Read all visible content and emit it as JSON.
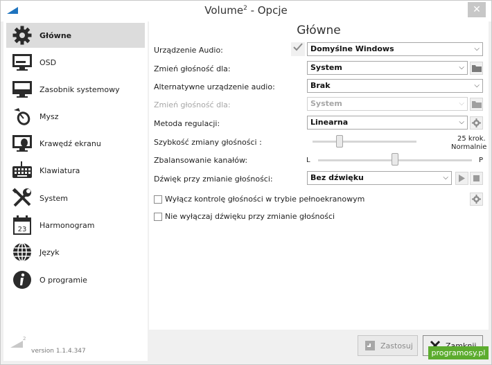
{
  "window": {
    "title": "Volume",
    "title_sup": "2",
    "title_suffix": " - Opcje",
    "close_glyph": "✕"
  },
  "sidebar": {
    "items": [
      {
        "label": "Główne",
        "icon": "gear-icon",
        "active": true
      },
      {
        "label": "OSD",
        "icon": "monitor-icon"
      },
      {
        "label": "Zasobnik systemowy",
        "icon": "tray-icon"
      },
      {
        "label": "Mysz",
        "icon": "mouse-icon"
      },
      {
        "label": "Krawędź ekranu",
        "icon": "screen-edge-icon"
      },
      {
        "label": "Klawiatura",
        "icon": "keyboard-icon"
      },
      {
        "label": "System",
        "icon": "tools-icon"
      },
      {
        "label": "Harmonogram",
        "icon": "calendar-icon"
      },
      {
        "label": "Język",
        "icon": "globe-icon"
      },
      {
        "label": "O programie",
        "icon": "info-icon"
      }
    ],
    "calendar_day": "23",
    "version": "version 1.1.4.347",
    "version_logo_sup": "2"
  },
  "main": {
    "title": "Główne",
    "audio_device": {
      "label": "Urządzenie Audio:",
      "value": "Domyślne Windows",
      "checked": true
    },
    "change_volume_for": {
      "label": "Zmień głośność dla:",
      "value": "System"
    },
    "alt_audio_device": {
      "label": "Alternatywne urządzenie audio:",
      "value": "Brak"
    },
    "change_volume_for_disabled": {
      "label": "Zmień głośność dla:",
      "value": "System"
    },
    "regulation_method": {
      "label": "Metoda regulacji:",
      "value": "Linearna"
    },
    "volume_speed": {
      "label": "Szybkość zmiany głośności :",
      "value_line1": "25 krok.",
      "value_line2": "Normalnie",
      "level": 0.26
    },
    "balance": {
      "label": "Zbalansowanie kanałów:",
      "left": "L",
      "right": "P",
      "level": 0.5
    },
    "sound_on_change": {
      "label": "Dźwięk przy zmianie głośności:",
      "value": "Bez dźwięku"
    },
    "checkbox_fullscreen": {
      "label": "Wyłącz kontrolę głośności w trybie pełnoekranowym",
      "checked": false
    },
    "checkbox_no_mute": {
      "label": "Nie wyłączaj dźwięku przy zmianie głośności",
      "checked": false
    }
  },
  "footer": {
    "apply_label": "Zastosuj",
    "close_label": "Zamknij"
  },
  "watermark": "programosy.pl",
  "colors": {
    "accent_blue": "#1e73be",
    "disabled_text": "#a6a6a6",
    "watermark_green": "#5cac2e"
  }
}
